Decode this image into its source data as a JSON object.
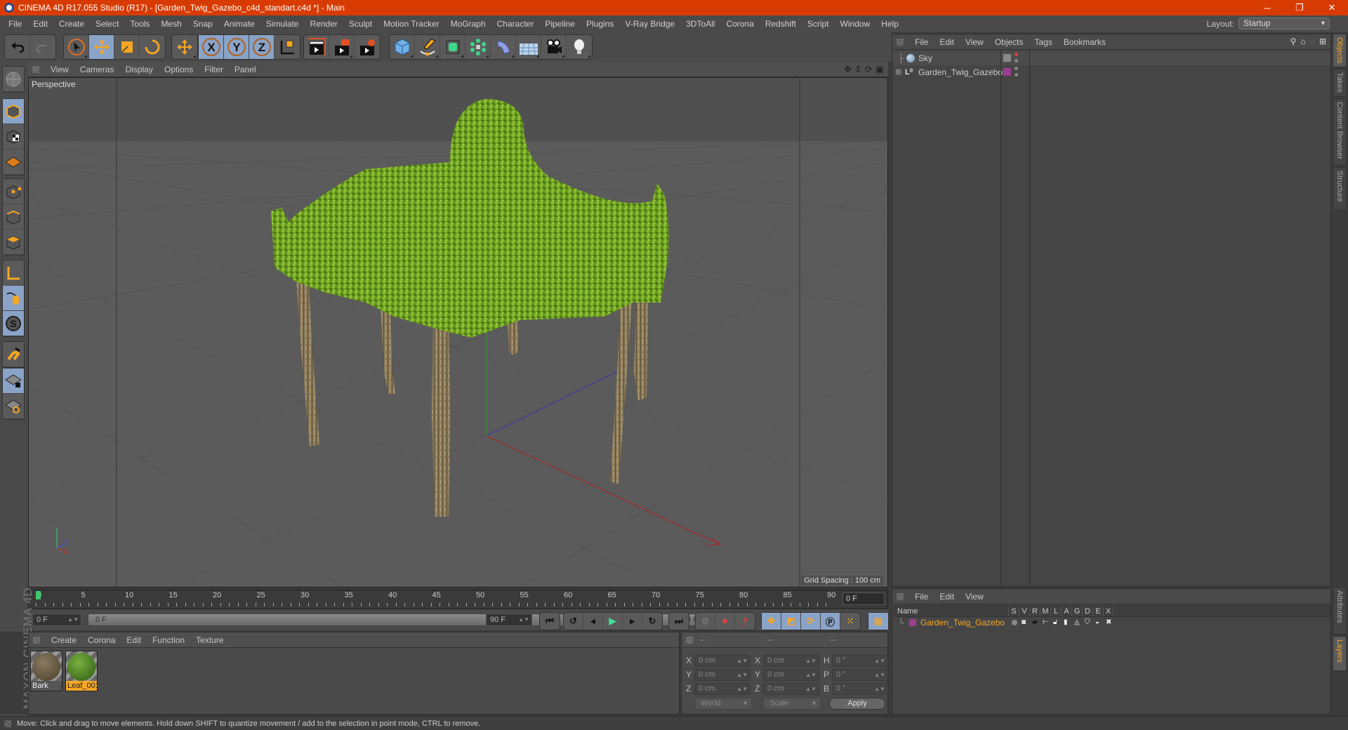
{
  "window": {
    "title": "CINEMA 4D R17.055 Studio (R17) - [Garden_Twig_Gazebo_c4d_standart.c4d *] - Main",
    "controls": [
      "minimize-icon",
      "restore-icon",
      "close-icon"
    ],
    "accent_color": "#d83b01"
  },
  "menubar": {
    "items": [
      "File",
      "Edit",
      "Create",
      "Select",
      "Tools",
      "Mesh",
      "Snap",
      "Animate",
      "Simulate",
      "Render",
      "Sculpt",
      "Motion Tracker",
      "MoGraph",
      "Character",
      "Pipeline",
      "Plugins",
      "V-Ray Bridge",
      "3DToAll",
      "Corona",
      "Redshift",
      "Script",
      "Window",
      "Help"
    ],
    "layout_label": "Layout:",
    "layout_value": "Startup"
  },
  "toolbar": {
    "groups": [
      [
        "undo-icon",
        "redo-icon"
      ],
      [
        "live-selection-icon",
        "move-icon",
        "scale-icon",
        "rotate-icon"
      ],
      [
        "recent-tool-icon"
      ],
      [
        "x-axis-lock-icon",
        "y-axis-lock-icon",
        "z-axis-lock-icon",
        "coordinate-system-icon"
      ],
      [
        "render-view-icon",
        "render-to-picture-viewer-icon",
        "render-settings-icon"
      ],
      [
        "cube-icon",
        "pen-spline-icon",
        "subdivision-surface-icon",
        "cloner-icon",
        "bend-deformer-icon",
        "floor-icon",
        "camera-icon",
        "light-icon"
      ]
    ],
    "active": [
      "move-icon",
      "x-axis-lock-icon",
      "y-axis-lock-icon",
      "z-axis-lock-icon"
    ]
  },
  "left_tools": [
    "make-editable-icon",
    "model-mode-icon",
    "texture-mode-icon",
    "workplane-mode-icon",
    "points-mode-icon",
    "edges-mode-icon",
    "polygons-mode-icon",
    "axis-mode-icon",
    "tweak-mode-icon",
    "solo-icon",
    "snap-icon",
    "lock-workplane-icon",
    "planar-workplane-icon"
  ],
  "viewport": {
    "menu": [
      "View",
      "Cameras",
      "Display",
      "Options",
      "Filter",
      "Panel"
    ],
    "label": "Perspective",
    "grid_spacing": "Grid Spacing : 100 cm",
    "nav_icons": [
      "pan-icon",
      "dolly-icon",
      "orbit-icon",
      "maximize-icon"
    ],
    "axis_labels": {
      "y": "Y",
      "z": "Z",
      "x": "X"
    }
  },
  "timeline": {
    "ticks": [
      "0",
      "5",
      "10",
      "15",
      "20",
      "25",
      "30",
      "35",
      "40",
      "45",
      "50",
      "55",
      "60",
      "65",
      "70",
      "75",
      "80",
      "85",
      "90"
    ],
    "current_frame": "0 F",
    "start_field": "0 F",
    "range_start": "0 F",
    "range_end": "90 F",
    "end_field": "90 F",
    "playhead_color": "#3ec96a"
  },
  "playback": {
    "buttons": [
      "go-to-start-icon",
      "previous-key-icon",
      "previous-frame-icon",
      "play-icon",
      "next-frame-icon",
      "next-key-icon",
      "go-to-end-icon",
      "record-disabled-icon",
      "autokey-icon",
      "keyframe-selection-icon",
      "key-position-icon",
      "key-scale-icon",
      "key-rotation-icon",
      "key-parameter-icon",
      "key-point-level-icon",
      "timeline-icon"
    ]
  },
  "material_manager": {
    "menu": [
      "Create",
      "Corona",
      "Edit",
      "Function",
      "Texture"
    ],
    "materials": [
      {
        "name": "Bark",
        "selected": false
      },
      {
        "name": "Leaf_001",
        "selected": true
      }
    ],
    "brand": "MAXON CINEMA 4D"
  },
  "coordinates": {
    "headers": [
      "--",
      "--",
      "--"
    ],
    "rows": [
      {
        "l1": "X",
        "v1": "0 cm",
        "l2": "X",
        "v2": "0 cm",
        "l3": "H",
        "v3": "0 °"
      },
      {
        "l1": "Y",
        "v1": "0 cm",
        "l2": "Y",
        "v2": "0 cm",
        "l3": "P",
        "v3": "0 °"
      },
      {
        "l1": "Z",
        "v1": "0 cm",
        "l2": "Z",
        "v2": "0 cm",
        "l3": "B",
        "v3": "0 °"
      }
    ],
    "mode": "World",
    "transform": "Scale",
    "apply": "Apply"
  },
  "object_manager": {
    "menu": [
      "File",
      "Edit",
      "View",
      "Objects",
      "Tags",
      "Bookmarks"
    ],
    "objects": [
      {
        "name": "Sky",
        "icon": "sky-icon"
      },
      {
        "name": "Garden_Twig_Gazebo",
        "icon": "null-object-icon",
        "layer_color": "#9b3f8c"
      }
    ]
  },
  "layer_manager": {
    "menu": [
      "File",
      "Edit",
      "View"
    ],
    "columns": [
      "Name",
      "S",
      "V",
      "R",
      "M",
      "L",
      "A",
      "G",
      "D",
      "E",
      "X"
    ],
    "layers": [
      {
        "name": "Garden_Twig_Gazebo",
        "color": "#9b3f8c",
        "text_color": "#f5a623"
      }
    ]
  },
  "side_tabs": {
    "top": [
      {
        "label": "Objects",
        "active": true
      },
      {
        "label": "Takes",
        "active": false
      },
      {
        "label": "Content Browser",
        "active": false
      },
      {
        "label": "Structure",
        "active": false
      }
    ],
    "bottom": [
      {
        "label": "Attributes",
        "active": false
      },
      {
        "label": "Layers",
        "active": true
      }
    ]
  },
  "statusbar": {
    "text": "Move: Click and drag to move elements. Hold down SHIFT to quantize movement / add to the selection in point mode, CTRL to remove."
  }
}
